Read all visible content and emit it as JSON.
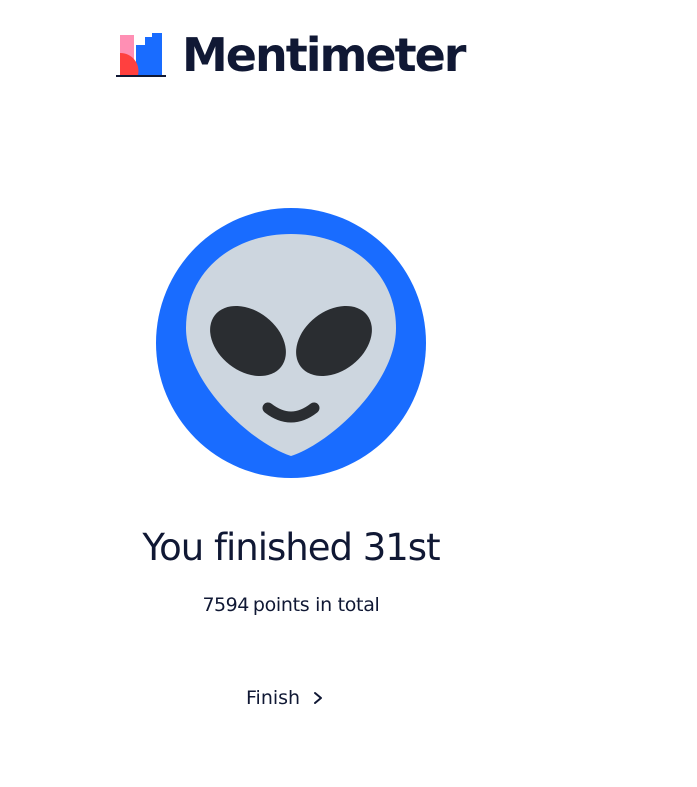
{
  "brand": {
    "name": "Mentimeter",
    "logo_icon": "mentimeter-logo-icon",
    "colors": {
      "pink": "#FF8FB4",
      "red": "#FF403F",
      "blue": "#196CFF",
      "text": "#101834"
    }
  },
  "avatar": {
    "icon": "alien-face-icon",
    "ring_color": "#196CFF",
    "face_color": "#CDD6DF",
    "feature_color": "#2A2D31"
  },
  "result": {
    "title": "You finished 31st",
    "points_value": "7594",
    "points_label": "points in total"
  },
  "actions": {
    "finish_label": "Finish",
    "finish_icon": "chevron-right-icon"
  }
}
